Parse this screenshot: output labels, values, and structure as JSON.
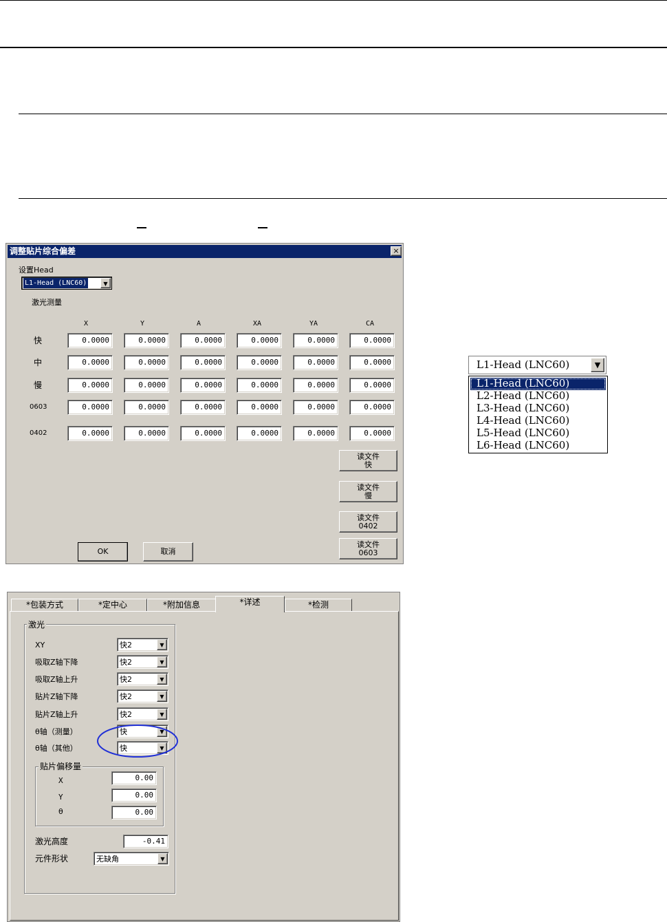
{
  "dialog1": {
    "title": "调整贴片综合偏差",
    "close": "×",
    "head_label": "设置Head",
    "head_value": "L1-Head  (LNC60)",
    "laser_label": "激光测量",
    "columns": [
      "X",
      "Y",
      "A",
      "XA",
      "YA",
      "CA"
    ],
    "rows": [
      {
        "label": "快",
        "values": [
          "0.0000",
          "0.0000",
          "0.0000",
          "0.0000",
          "0.0000",
          "0.0000"
        ]
      },
      {
        "label": "中",
        "values": [
          "0.0000",
          "0.0000",
          "0.0000",
          "0.0000",
          "0.0000",
          "0.0000"
        ]
      },
      {
        "label": "慢",
        "values": [
          "0.0000",
          "0.0000",
          "0.0000",
          "0.0000",
          "0.0000",
          "0.0000"
        ]
      },
      {
        "label": "0603",
        "values": [
          "0.0000",
          "0.0000",
          "0.0000",
          "0.0000",
          "0.0000",
          "0.0000"
        ]
      },
      {
        "label": "0402",
        "values": [
          "0.0000",
          "0.0000",
          "0.0000",
          "0.0000",
          "0.0000",
          "0.0000"
        ]
      }
    ],
    "read_buttons": [
      {
        "line1": "读文件",
        "line2": "快"
      },
      {
        "line1": "读文件",
        "line2": "慢"
      },
      {
        "line1": "读文件",
        "line2": "0402"
      },
      {
        "line1": "读文件",
        "line2": "0603"
      }
    ],
    "ok": "OK",
    "cancel": "取消"
  },
  "dropdown": {
    "selected": "L1-Head   (LNC60)",
    "options": [
      "L1-Head   (LNC60)",
      "L2-Head   (LNC60)",
      "L3-Head   (LNC60)",
      "L4-Head   (LNC60)",
      "L5-Head   (LNC60)",
      "L6-Head   (LNC60)"
    ]
  },
  "dialog2": {
    "tabs": [
      "*包装方式",
      "*定中心",
      "*附加信息",
      "*详述",
      "*检测"
    ],
    "active_tab": "*详述",
    "laser_group": "激光",
    "speed_rows": [
      {
        "label": "XY",
        "value": "快2"
      },
      {
        "label": "吸取Z轴下降",
        "value": "快2"
      },
      {
        "label": "吸取Z轴上升",
        "value": "快2"
      },
      {
        "label": "贴片Z轴下降",
        "value": "快2"
      },
      {
        "label": "贴片Z轴上升",
        "value": "快2"
      },
      {
        "label": "θ轴（测量）",
        "value": "快"
      },
      {
        "label": "θ轴（其他）",
        "value": "快"
      }
    ],
    "offset_group": "贴片偏移量",
    "offsets": [
      {
        "label": "X",
        "value": "0.00"
      },
      {
        "label": "Y",
        "value": "0.00"
      },
      {
        "label": "θ",
        "value": "0.00"
      }
    ],
    "laser_height_label": "激光高度",
    "laser_height_value": "-0.41",
    "shape_label": "元件形状",
    "shape_value": "无缺角"
  },
  "colors": {
    "titlebar": "#0a246a",
    "face": "#d4d0c8",
    "highlight_circle": "#1f2fd6"
  }
}
